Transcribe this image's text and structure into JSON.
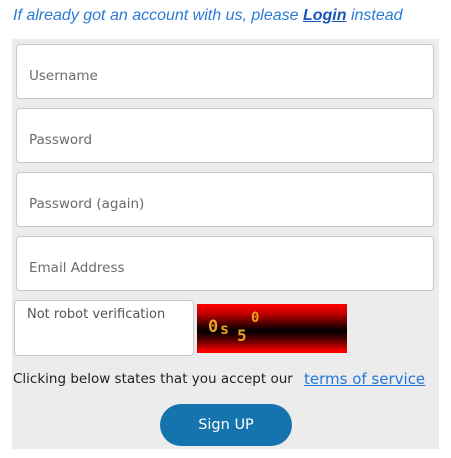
{
  "header": {
    "prefix": "If already got an account with us, please ",
    "login_link": "Login",
    "suffix": " instead"
  },
  "form": {
    "username_placeholder": "Username",
    "password_placeholder": "Password",
    "password_again_placeholder": "Password (again)",
    "email_placeholder": "Email Address",
    "captcha_placeholder": "Not robot verification",
    "captcha_chars": [
      "0",
      "s",
      "5",
      "0"
    ],
    "captcha_colors": {
      "text": "#e8a020",
      "background_edge": "#ff0000",
      "background_center": "#000000"
    }
  },
  "terms": {
    "text": "Clicking below states that you accept our",
    "link": "terms of service"
  },
  "signup": {
    "label": "Sign UP",
    "color": "#1573ad"
  },
  "colors": {
    "panel_bg": "#ececec",
    "header_text": "#2b7bd6",
    "link": "#2277dd"
  }
}
